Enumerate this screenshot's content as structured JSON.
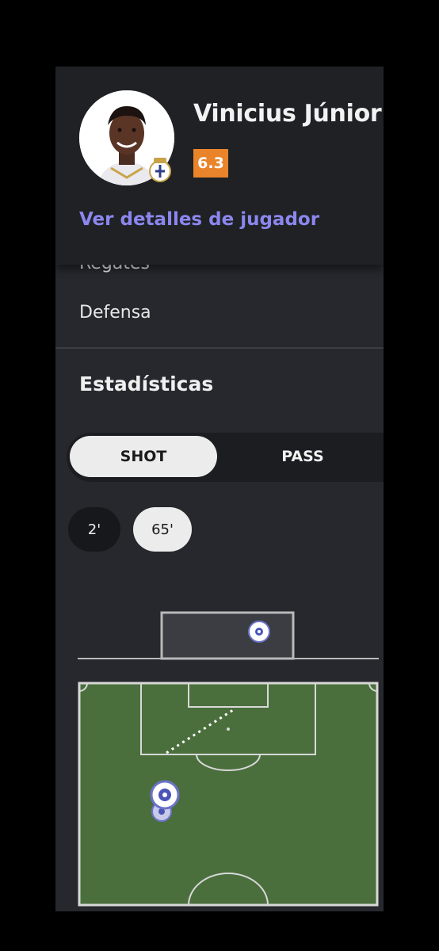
{
  "player": {
    "name": "Vinicius Júnior",
    "rating": "6.3",
    "rating_color": "#e9842b",
    "details_link": "Ver detalles de jugador"
  },
  "stats_menu": {
    "cut_item": "Regates",
    "defensa": "Defensa"
  },
  "section": {
    "title": "Estadísticas"
  },
  "toggle": {
    "shot_label": "SHOT",
    "pass_label": "PASS",
    "selected": "SHOT"
  },
  "minutes": [
    {
      "label": "2'",
      "selected": false
    },
    {
      "label": "65'",
      "selected": true
    }
  ],
  "colors": {
    "panel": "#26282d",
    "header": "#1f2125",
    "link": "#8b87ee",
    "pitch": "#4a6f3d"
  }
}
